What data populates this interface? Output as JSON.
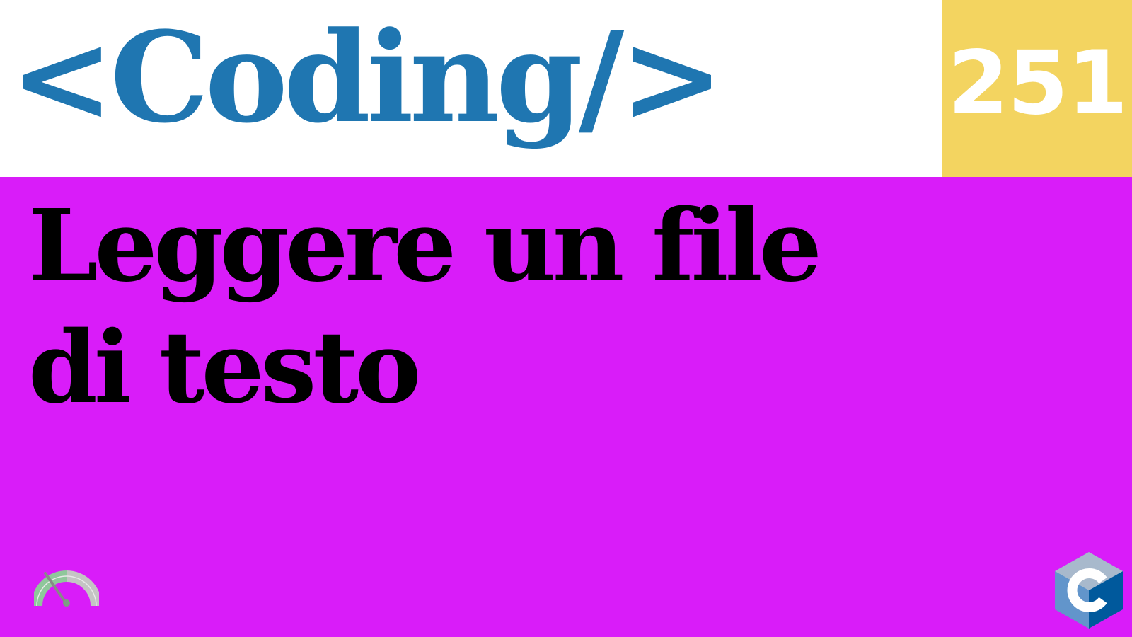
{
  "header": {
    "brand": "<Coding/>",
    "episode_number": "251",
    "brand_color": "#1f76b1",
    "episode_bg": "#f3d460"
  },
  "main": {
    "title": "Leggere un file di testo",
    "background": "#d91cf9"
  },
  "icons": {
    "gauge": "gauge-icon",
    "language_logo": "c-language-logo-icon"
  }
}
